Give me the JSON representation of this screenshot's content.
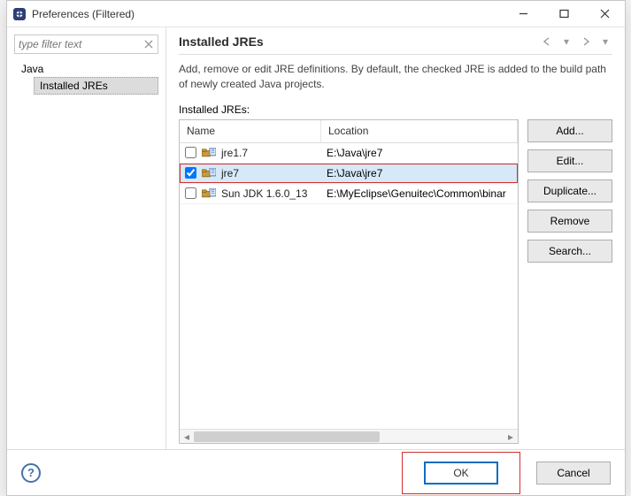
{
  "window": {
    "title": "Preferences (Filtered)"
  },
  "sidebar": {
    "filter_placeholder": "type filter text",
    "tree": {
      "root": "Java",
      "child": "Installed JREs"
    }
  },
  "main": {
    "heading": "Installed JREs",
    "description": "Add, remove or edit JRE definitions. By default, the checked JRE is added to the build path of newly created Java projects.",
    "list_label": "Installed JREs:",
    "columns": {
      "name": "Name",
      "location": "Location"
    },
    "rows": [
      {
        "checked": false,
        "name": "jre1.7",
        "location": "E:\\Java\\jre7",
        "selected": false,
        "boxed": false
      },
      {
        "checked": true,
        "name": "jre7",
        "location": "E:\\Java\\jre7",
        "selected": true,
        "boxed": true
      },
      {
        "checked": false,
        "name": "Sun JDK 1.6.0_13",
        "location": "E:\\MyEclipse\\Genuitec\\Common\\binar",
        "selected": false,
        "boxed": false
      }
    ],
    "buttons": {
      "add": "Add...",
      "edit": "Edit...",
      "duplicate": "Duplicate...",
      "remove": "Remove",
      "search": "Search..."
    }
  },
  "footer": {
    "ok": "OK",
    "cancel": "Cancel"
  }
}
